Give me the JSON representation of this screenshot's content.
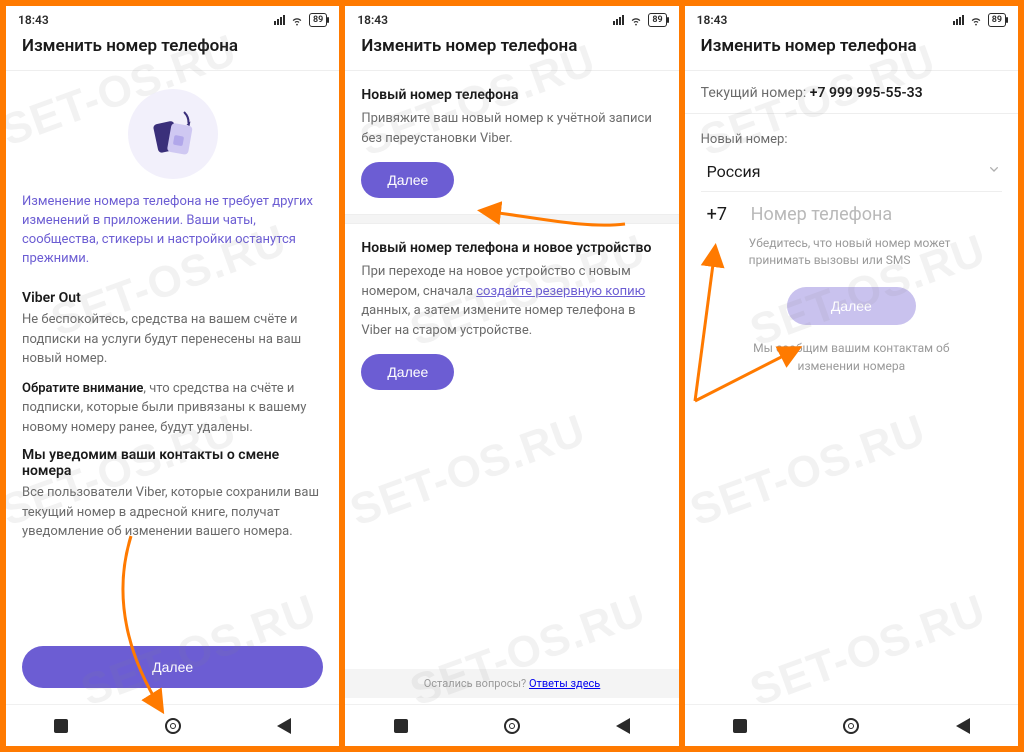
{
  "watermark": "SET-OS.RU",
  "status": {
    "time": "18:43",
    "battery": "89"
  },
  "header": {
    "title": "Изменить номер телефона"
  },
  "nav": {
    "square": "square",
    "circle": "circle",
    "triangle": "back"
  },
  "panel1": {
    "intro": "Изменение номера телефона не требует других изменений в приложении. Ваши чаты, сообщества, стикеры и настройки останутся прежними.",
    "viber_out_title": "Viber Out",
    "viber_out_body": "Не беспокойтесь, средства на вашем счёте и подписки на услуги будут перенесены на ваш новый номер.",
    "note_bold": "Обратите внимание",
    "note_rest": ", что средства на счёте и подписки, которые были привязаны к вашему новому номеру ранее, будут удалены.",
    "notify_title": "Мы уведомим ваши контакты о смене номера",
    "notify_body": "Все пользователи Viber, которые сохранили ваш текущий номер в адресной книге, получат уведомление об изменении вашего номера.",
    "next": "Далее"
  },
  "panel2": {
    "s1_title": "Новый номер телефона",
    "s1_body": "Привяжите ваш новый номер к учётной записи без переустановки Viber.",
    "s1_btn": "Далее",
    "s2_title": "Новый номер телефона и новое устройство",
    "s2_body_a": "При переходе на новое устройство с новым номером, сначала ",
    "s2_link": "создайте резервную копию",
    "s2_body_b": " данных, а затем измените номер телефона в Viber на старом устройстве.",
    "s2_btn": "Далее",
    "footer_q": "Остались вопросы? ",
    "footer_link": "Ответы здесь"
  },
  "panel3": {
    "current_label": "Текущий номер: ",
    "current_value": "+7 999 995-55-33",
    "new_label": "Новый номер:",
    "country": "Россия",
    "cc": "+7",
    "placeholder": "Номер телефона",
    "hint": "Убедитесь, что новый номер может принимать вызовы или SMS",
    "next": "Далее",
    "contacts_note": "Мы сообщим вашим контактам об изменении номера"
  }
}
